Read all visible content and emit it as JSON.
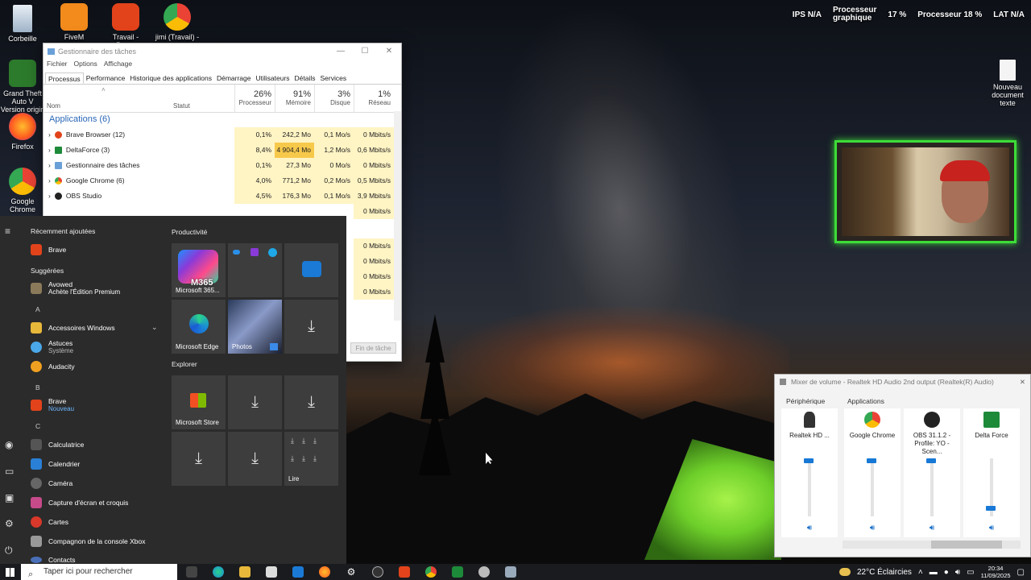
{
  "desktop": {
    "icons": [
      {
        "label": "Corbeille"
      },
      {
        "label": "FiveM"
      },
      {
        "label": "Travail - Brave"
      },
      {
        "label": "jimi (Travail) -"
      },
      {
        "label": "Grand Theft Auto V Version origin"
      },
      {
        "label": "Firefox"
      },
      {
        "label": "Google Chrome"
      },
      {
        "label": "Nouveau document texte"
      }
    ]
  },
  "osd": {
    "ips_label": "IPS",
    "ips_value": "N/A",
    "gpu_label_1": "Processeur",
    "gpu_label_2": "graphique",
    "gpu_value": "17 %",
    "cpu_label": "Processeur",
    "cpu_value": "18 %",
    "lat_label": "LAT",
    "lat_value": "N/A"
  },
  "task_manager": {
    "title": "Gestionnaire des tâches",
    "menu": [
      "Fichier",
      "Options",
      "Affichage"
    ],
    "tabs": [
      "Processus",
      "Performance",
      "Historique des applications",
      "Démarrage",
      "Utilisateurs",
      "Détails",
      "Services"
    ],
    "columns": {
      "name": "Nom",
      "status": "Statut",
      "cpu_pct": "26%",
      "cpu": "Processeur",
      "mem_pct": "91%",
      "mem": "Mémoire",
      "disk_pct": "3%",
      "disk": "Disque",
      "net_pct": "1%",
      "net": "Réseau"
    },
    "group": "Applications (6)",
    "rows": [
      {
        "name": "Brave Browser (12)",
        "cpu": "0,1%",
        "mem": "242,2 Mo",
        "disk": "0,1 Mo/s",
        "net": "0 Mbits/s"
      },
      {
        "name": "DeltaForce (3)",
        "cpu": "8,4%",
        "mem": "4 904,4 Mo",
        "disk": "1,2 Mo/s",
        "net": "0,6 Mbits/s"
      },
      {
        "name": "Gestionnaire des tâches",
        "cpu": "0,1%",
        "mem": "27,3 Mo",
        "disk": "0 Mo/s",
        "net": "0 Mbits/s"
      },
      {
        "name": "Google Chrome (6)",
        "cpu": "4,0%",
        "mem": "771,2 Mo",
        "disk": "0,2 Mo/s",
        "net": "0,5 Mbits/s"
      },
      {
        "name": "OBS Studio",
        "cpu": "4,5%",
        "mem": "176,3 Mo",
        "disk": "0,1 Mo/s",
        "net": "3,9 Mbits/s"
      }
    ],
    "hidden_net_values": [
      "0 Mbits/s",
      "0 Mbits/s",
      "0 Mbits/s",
      "0 Mbits/s",
      "0 Mbits/s",
      "0 Mbits/s"
    ],
    "end_task": "Fin de tâche"
  },
  "start_menu": {
    "recent_header": "Récemment ajoutées",
    "suggested_header": "Suggérées",
    "productivity_header": "Productivité",
    "explorer_header": "Explorer",
    "apps": {
      "brave": "Brave",
      "avowed": "Avowed",
      "avowed_sub": "Achète l'Édition Premium",
      "letter_a": "A",
      "accessoires": "Accessoires Windows",
      "astuces": "Astuces",
      "astuces_sub": "Système",
      "audacity": "Audacity",
      "letter_b": "B",
      "brave2": "Brave",
      "brave2_sub": "Nouveau",
      "letter_c": "C",
      "calculatrice": "Calculatrice",
      "calendrier": "Calendrier",
      "camera": "Caméra",
      "capture": "Capture d'écran et croquis",
      "cartes": "Cartes",
      "compagnon": "Compagnon de la console Xbox",
      "contacts": "Contacts"
    },
    "tiles": {
      "m365": "Microsoft 365...",
      "m365_badge": "M365",
      "edge": "Microsoft Edge",
      "photos": "Photos",
      "store": "Microsoft Store",
      "lire": "Lire"
    }
  },
  "mixer": {
    "title": "Mixer de volume - Realtek HD Audio 2nd output (Realtek(R) Audio)",
    "device_header": "Périphérique",
    "apps_header": "Applications",
    "channels": [
      {
        "name": "Realtek HD ...",
        "level": 1.0
      },
      {
        "name": "Google Chrome",
        "level": 1.0
      },
      {
        "name": "OBS 31.1.2 - Profile: YO - Scen...",
        "level": 1.0
      },
      {
        "name": "Delta Force",
        "level": 0.1
      }
    ]
  },
  "taskbar": {
    "search_placeholder": "Taper ici pour rechercher",
    "weather": "22°C  Éclaircies",
    "time": "20:34",
    "date": "11/09/2025"
  },
  "colors": {
    "accent": "#1778d6",
    "overlay_green": "#3ddc38",
    "heat_low": "#fff4c4",
    "heat_high": "#f7c94b"
  }
}
